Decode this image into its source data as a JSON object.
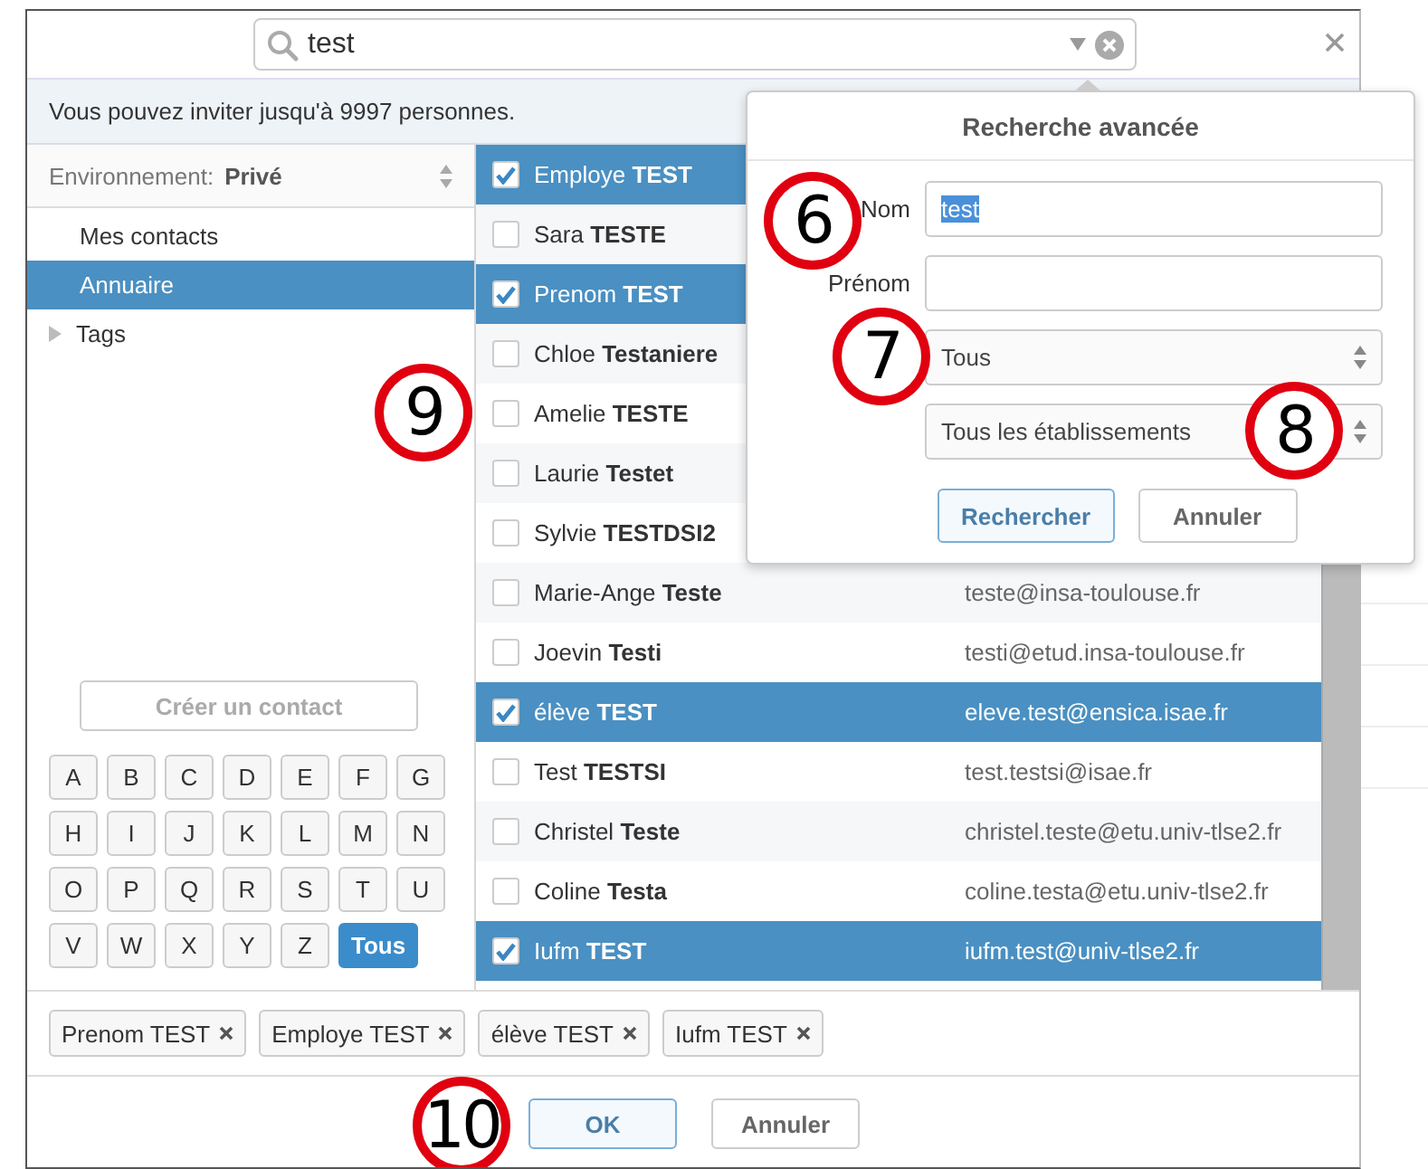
{
  "search": {
    "value": "test"
  },
  "info": "Vous pouvez inviter jusqu'à 9997 personnes.",
  "environment": {
    "label": "Environnement:",
    "value": "Privé"
  },
  "nav": [
    {
      "label": "Mes contacts",
      "kind": "item",
      "selected": false
    },
    {
      "label": "Annuaire",
      "kind": "item",
      "selected": true,
      "callout": "9"
    },
    {
      "label": "Tags",
      "kind": "group",
      "selected": false
    }
  ],
  "create_button": {
    "label": "Créer un contact",
    "disabled": true
  },
  "letters": [
    {
      "label": "A",
      "selected": false
    },
    {
      "label": "B",
      "selected": false
    },
    {
      "label": "C",
      "selected": false
    },
    {
      "label": "D",
      "selected": false
    },
    {
      "label": "E",
      "selected": false
    },
    {
      "label": "F",
      "selected": false
    },
    {
      "label": "G",
      "selected": false
    },
    {
      "label": "H",
      "selected": false
    },
    {
      "label": "I",
      "selected": false
    },
    {
      "label": "J",
      "selected": false
    },
    {
      "label": "K",
      "selected": false
    },
    {
      "label": "L",
      "selected": false
    },
    {
      "label": "M",
      "selected": false
    },
    {
      "label": "N",
      "selected": false
    },
    {
      "label": "O",
      "selected": false
    },
    {
      "label": "P",
      "selected": false
    },
    {
      "label": "Q",
      "selected": false
    },
    {
      "label": "R",
      "selected": false
    },
    {
      "label": "S",
      "selected": false
    },
    {
      "label": "T",
      "selected": false
    },
    {
      "label": "U",
      "selected": false
    },
    {
      "label": "V",
      "selected": false
    },
    {
      "label": "W",
      "selected": false
    },
    {
      "label": "X",
      "selected": false
    },
    {
      "label": "Y",
      "selected": false
    },
    {
      "label": "Z",
      "selected": false
    },
    {
      "label": "Tous",
      "selected": true
    }
  ],
  "contacts": [
    {
      "name": "Employe **TEST**",
      "checked": true
    },
    {
      "name": "Sara **TESTE**",
      "checked": false
    },
    {
      "name": "Prenom **TEST**",
      "checked": true
    },
    {
      "name": "Chloe **Testaniere**",
      "checked": false
    },
    {
      "name": "Amelie **TESTE**",
      "checked": false
    },
    {
      "name": "Laurie **Testet**",
      "checked": false
    },
    {
      "name": "Sylvie **TESTDSI2**",
      "checked": false
    },
    {
      "name": "Marie-Ange **Teste**",
      "email": "teste@insa-toulouse.fr",
      "checked": false
    },
    {
      "name": "Joevin **Testi**",
      "email": "testi@etud.insa-toulouse.fr",
      "checked": false
    },
    {
      "name": "élève **TEST**",
      "email": "eleve.test@ensica.isae.fr",
      "checked": true
    },
    {
      "name": "Test **TESTSI**",
      "email": "test.testsi@isae.fr",
      "checked": false
    },
    {
      "name": "Christel **Teste**",
      "email": "christel.teste@etu.univ-tlse2.fr",
      "checked": false
    },
    {
      "name": "Coline **Testa**",
      "email": "coline.testa@etu.univ-tlse2.fr",
      "checked": false
    },
    {
      "name": "Iufm **TEST**",
      "email": "iufm.test@univ-tlse2.fr",
      "checked": true
    }
  ],
  "selected_tags": [
    "Prenom TEST",
    "Employe TEST",
    "élève TEST",
    "Iufm TEST"
  ],
  "buttons": [
    {
      "label": "OK",
      "kind": "primary",
      "callout": "10"
    },
    {
      "label": "Annuler",
      "kind": "secondary"
    }
  ],
  "advanced_search": {
    "title": "Recherche avancée",
    "fields": [
      {
        "kind": "text",
        "label": "Nom",
        "value": "test",
        "value_selected": true,
        "callout": "6"
      },
      {
        "kind": "text",
        "label": "Prénom"
      },
      {
        "kind": "select",
        "value": "Tous",
        "callout": "7"
      },
      {
        "kind": "select",
        "value": "Tous les établissements",
        "callout": "8"
      }
    ],
    "buttons": [
      {
        "label": "Rechercher",
        "kind": "primary"
      },
      {
        "label": "Annuler",
        "kind": "secondary"
      }
    ]
  }
}
